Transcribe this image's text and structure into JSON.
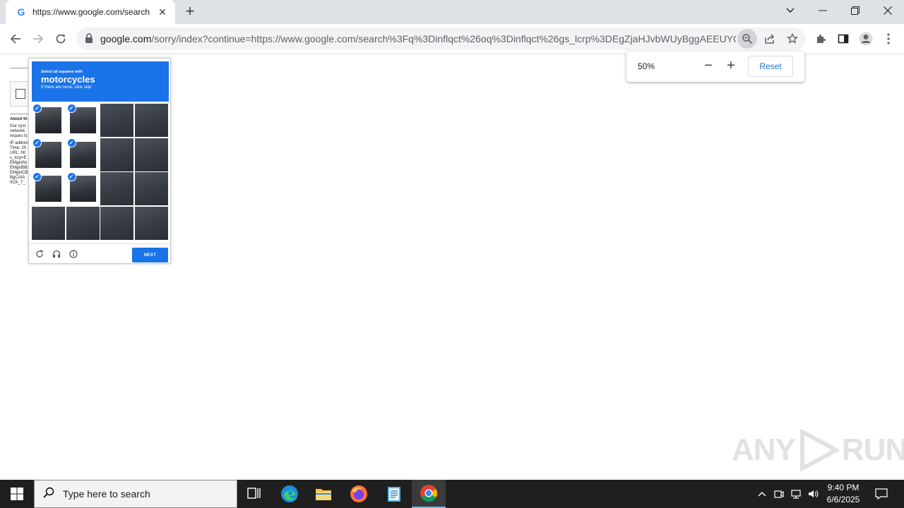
{
  "browser": {
    "tab": {
      "title": "https://www.google.com/search",
      "favicon": "google-g-icon"
    },
    "address_bar": {
      "host": "google.com",
      "path": "/sorry/index?continue=https://www.google.com/search%3Fq%3Dinflqct%26oq%3Dinflqct%26gs_lcrp%3DEgZjaHJvbWUyBggAEEUYOT..."
    },
    "zoom_popup": {
      "value": "50%",
      "minus": "−",
      "plus": "+",
      "reset_label": "Reset"
    }
  },
  "page": {
    "about_label": "About th",
    "body_lines": [
      "Our syst",
      "network.",
      "reques ts"
    ],
    "details_lines": [
      "IP addres",
      "Time: 20",
      "URL: htt",
      "s_lcrp=E",
      "EMgkIAh",
      "EMgkIBB",
      "EMgkICB",
      "BgCAIA",
      "0CK_7_"
    ]
  },
  "captcha": {
    "instruction_small": "Select all squares with",
    "target": "motorcycles",
    "hint": "If there are none, click skip",
    "next_label": "NEXT",
    "selected_cells": [
      0,
      1,
      4,
      5,
      8,
      9
    ]
  },
  "watermark": {
    "left": "ANY",
    "right": "RUN"
  },
  "taskbar": {
    "search_placeholder": "Type here to search",
    "time": "9:40 PM",
    "date": "6/6/2025"
  }
}
